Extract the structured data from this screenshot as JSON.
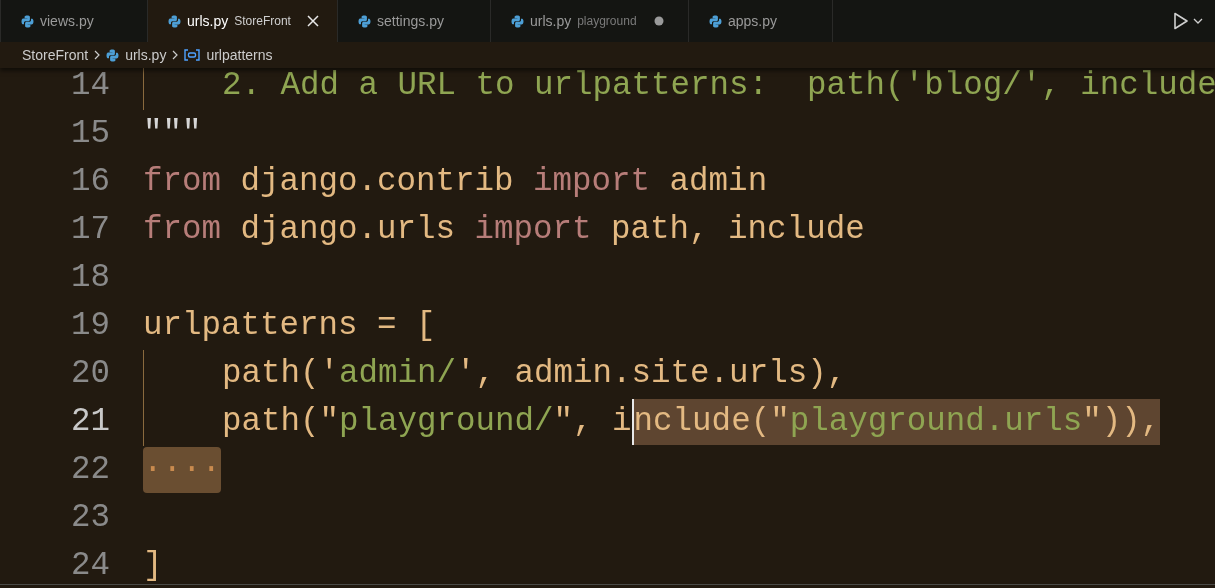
{
  "tabs": [
    {
      "label": "views.py",
      "selected": false,
      "modified": false
    },
    {
      "label": "urls.py",
      "detail": "StoreFront",
      "selected": true,
      "modified": false
    },
    {
      "label": "settings.py",
      "selected": false,
      "modified": false
    },
    {
      "label": "urls.py",
      "detail": "playground",
      "selected": false,
      "modified": true
    },
    {
      "label": "apps.py",
      "selected": false,
      "modified": false
    }
  ],
  "breadcrumb": [
    {
      "label": "StoreFront",
      "kind": "folder"
    },
    {
      "label": "urls.py",
      "kind": "file"
    },
    {
      "label": "urlpatterns",
      "kind": "variable"
    }
  ],
  "lines": [
    {
      "number": "14",
      "active": false,
      "guide": true,
      "tokens": [
        {
          "t": "    2. Add a URL to urlpatterns:  path('blog/', include",
          "kind": "comment",
          "selected": false
        }
      ]
    },
    {
      "number": "15",
      "active": false,
      "guide": false,
      "tokens": [
        {
          "t": "\"\"\"",
          "kind": "plain",
          "selected": false
        }
      ]
    },
    {
      "number": "16",
      "active": false,
      "guide": false,
      "tokens": [
        {
          "t": "from",
          "kind": "keyword",
          "selected": false
        },
        {
          "t": " django.contrib ",
          "kind": "id",
          "selected": false
        },
        {
          "t": "import",
          "kind": "keyword",
          "selected": false
        },
        {
          "t": " admin",
          "kind": "id",
          "selected": false
        }
      ]
    },
    {
      "number": "17",
      "active": false,
      "guide": false,
      "tokens": [
        {
          "t": "from",
          "kind": "keyword",
          "selected": false
        },
        {
          "t": " django.urls ",
          "kind": "id",
          "selected": false
        },
        {
          "t": "import",
          "kind": "keyword",
          "selected": false
        },
        {
          "t": " path, include",
          "kind": "id",
          "selected": false
        }
      ]
    },
    {
      "number": "18",
      "active": false,
      "guide": false
    },
    {
      "number": "19",
      "active": false,
      "guide": false,
      "tokens": [
        {
          "t": "urlpatterns = [",
          "kind": "id",
          "selected": false
        }
      ]
    },
    {
      "number": "20",
      "active": false,
      "guide": true,
      "tokens": [
        {
          "t": "    path('",
          "kind": "id",
          "selected": false
        },
        {
          "t": "admin/",
          "kind": "string",
          "selected": false
        },
        {
          "t": "', admin.site.urls),",
          "kind": "id",
          "selected": false
        }
      ]
    },
    {
      "number": "21",
      "active": true,
      "guide": true,
      "tokens": [
        {
          "t": "    path(\"",
          "kind": "id",
          "selected": false
        },
        {
          "t": "playground/",
          "kind": "string",
          "selected": false
        },
        {
          "t": "\", i",
          "kind": "id",
          "selected": false
        },
        {
          "t": "nclude(\"",
          "kind": "id",
          "selected": true
        },
        {
          "t": "playground.urls",
          "kind": "string",
          "selected": true
        },
        {
          "t": "\")),",
          "kind": "id",
          "selected": true
        }
      ]
    },
    {
      "number": "22",
      "active": false,
      "guide": false,
      "tokens": [
        {
          "t": "····",
          "kind": "whitespace",
          "selected": true
        }
      ]
    },
    {
      "number": "23",
      "active": false,
      "guide": false
    },
    {
      "number": "24",
      "active": false,
      "guide": false,
      "tokens": [
        {
          "t": "]",
          "kind": "id",
          "selected": false
        }
      ]
    }
  ]
}
